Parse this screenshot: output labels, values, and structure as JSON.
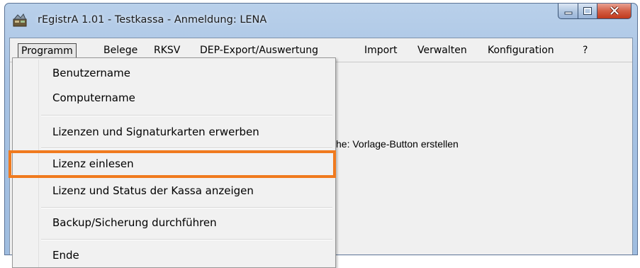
{
  "window": {
    "title": "rEgistrA 1.01 - Testkassa - Anmeldung: LENA",
    "controls": {
      "minimize_icon": "minimize-icon",
      "maximize_icon": "maximize-icon",
      "close_icon": "close-icon"
    }
  },
  "menubar": {
    "items": [
      {
        "label": "Programm",
        "open": true
      },
      {
        "label": "Belege"
      },
      {
        "label": "RKSV"
      },
      {
        "label": "DEP-Export/Auswertung"
      },
      {
        "label": "Import"
      },
      {
        "label": "Verwalten"
      },
      {
        "label": "Konfiguration"
      },
      {
        "label": "?"
      }
    ]
  },
  "dropdown": {
    "items": [
      {
        "label": "Benutzername"
      },
      {
        "label": "Computername"
      },
      {
        "label": "Lizenzen und Signaturkarten erwerben"
      },
      {
        "label": "Lizenz einlesen",
        "highlighted": true
      },
      {
        "label": "Lizenz und Status der Kassa anzeigen"
      },
      {
        "label": "Backup/Sicherung durchführen"
      },
      {
        "label": "Ende"
      }
    ]
  },
  "background": {
    "partial_text": "che: Vorlage-Button erstellen"
  },
  "colors": {
    "highlight_outline": "#f07a1e",
    "titlebar": "#a8c3e4",
    "close_button": "#c8452a"
  }
}
